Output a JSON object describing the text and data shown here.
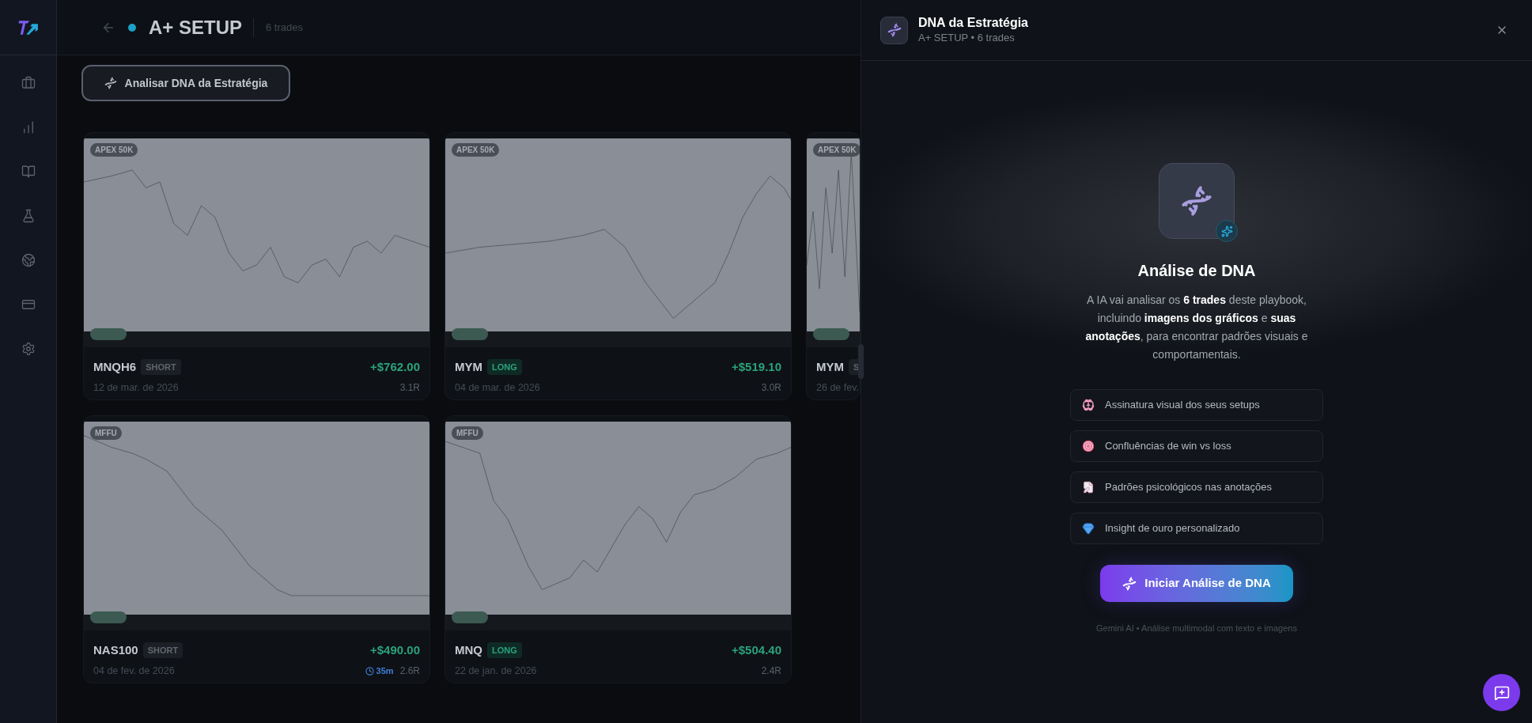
{
  "header": {
    "title": "A+ SETUP",
    "color": "#1ba1c6",
    "count": "6 trades"
  },
  "analyze_button": {
    "label": "Analisar DNA da Estratégia"
  },
  "trades": [
    {
      "account": "APEX 50K",
      "symbol": "MNQH6",
      "side": "SHORT",
      "kind": "short",
      "pnl": "+$762.00",
      "date": "12 de mar. de 2026",
      "r": "3.1R"
    },
    {
      "account": "APEX 50K",
      "symbol": "MYM",
      "side": "LONG",
      "kind": "long",
      "pnl": "+$519.10",
      "date": "04 de mar. de 2026",
      "r": "3.0R"
    },
    {
      "account": "APEX 50K",
      "symbol": "MYM",
      "side": "S",
      "kind": "short",
      "date": "26 de fev."
    },
    {
      "account": "MFFU",
      "symbol": "NAS100",
      "side": "SHORT",
      "kind": "short",
      "pnl": "+$490.00",
      "date": "04 de fev. de 2026",
      "duration": "35m",
      "r": "2.6R"
    },
    {
      "account": "MFFU",
      "symbol": "MNQ",
      "side": "LONG",
      "kind": "long",
      "pnl": "+$504.40",
      "date": "22 de jan. de 2026",
      "r": "2.4R"
    }
  ],
  "panel": {
    "title": "DNA da Estratégia",
    "subtitle": "A+ SETUP • 6 trades",
    "heading": "Análise de DNA",
    "description": "A IA vai analisar os **6 trades** deste playbook, incluindo **imagens dos gráficos** e **suas anotações**, para encontrar padrões visuais e comportamentais.",
    "features": [
      {
        "text": "Assinatura visual dos seus setups"
      },
      {
        "text": "Confluências de win vs loss"
      },
      {
        "text": "Padrões psicológicos nas anotações"
      },
      {
        "text": "Insight de ouro personalizado"
      }
    ],
    "start_button": "Iniciar Análise de DNA",
    "footnote": "Gemini AI • Análise multimodal com texto e imagens"
  }
}
